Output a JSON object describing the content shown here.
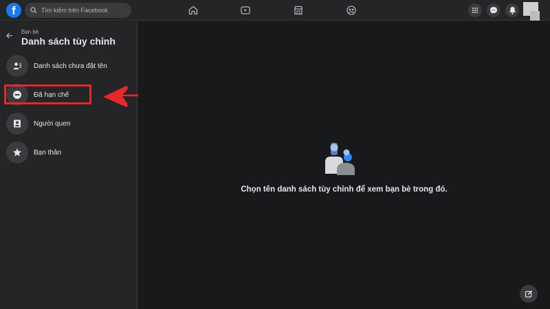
{
  "header": {
    "logo_text": "f",
    "search_placeholder": "Tìm kiếm trên Facebook",
    "nav_icons": [
      "home-icon",
      "watch-icon",
      "marketplace-icon",
      "groups-icon"
    ],
    "right_icons": [
      "menu-grid-icon",
      "messenger-icon",
      "notifications-icon"
    ],
    "accent_color": "#1877f2"
  },
  "sidebar": {
    "breadcrumb": "Bạn bè",
    "title": "Danh sách tùy chỉnh",
    "items": [
      {
        "label": "Danh sách chưa đặt tên",
        "icon": "person-list-icon"
      },
      {
        "label": "Đã hạn chế",
        "icon": "restricted-icon"
      },
      {
        "label": "Người quen",
        "icon": "contact-card-icon"
      },
      {
        "label": "Bạn thân",
        "icon": "star-icon"
      }
    ]
  },
  "main": {
    "empty_message": "Chọn tên danh sách tùy chỉnh để xem bạn bè trong đó."
  },
  "annotation": {
    "highlight_color": "#e8262b"
  }
}
